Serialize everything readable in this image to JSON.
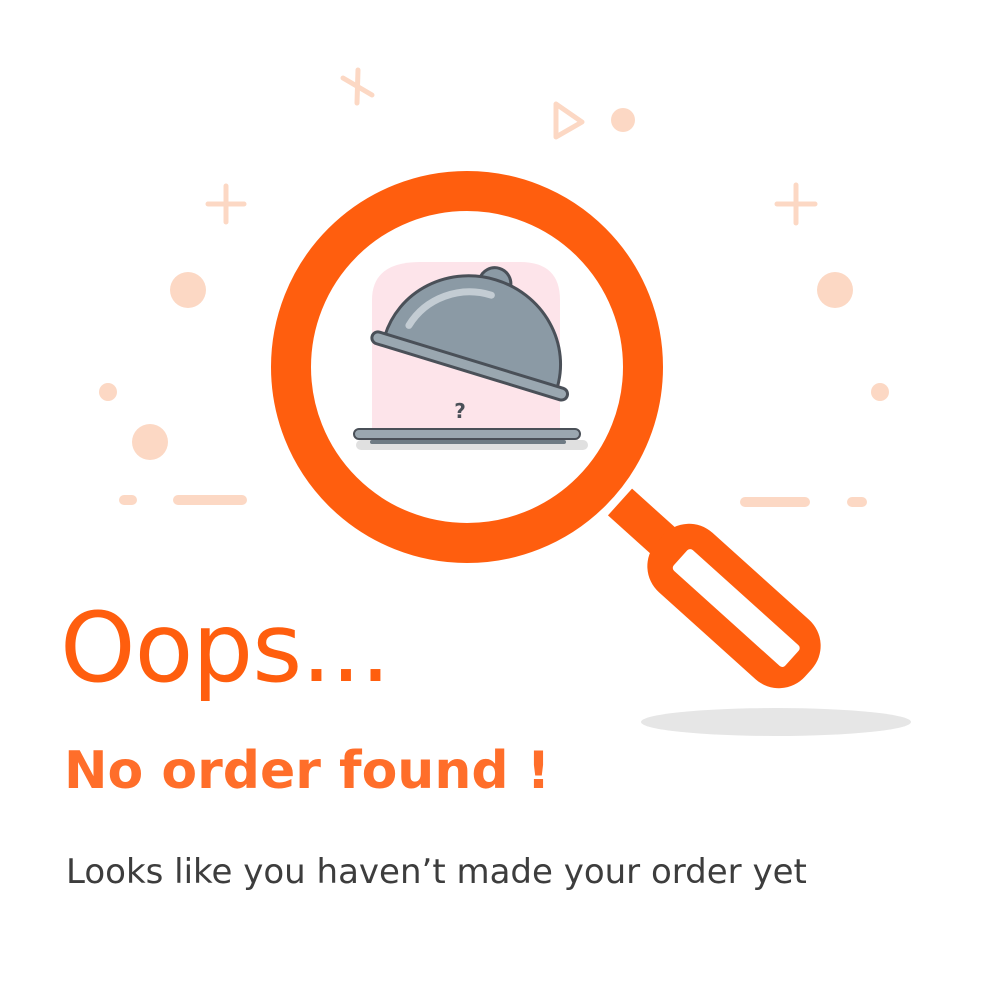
{
  "colors": {
    "accent": "#ff5e0e",
    "accent_light": "#ff6e2a",
    "decor_peach": "#fcd8c4",
    "text_dark": "#3d3d3d",
    "cloche_metal": "#8b9aa5",
    "tray": "#9aa7b0",
    "pink_bg": "#fde4ea",
    "shadow": "#e6e6e6"
  },
  "illustration": {
    "magnifier_icon": "magnifying-glass-icon",
    "cloche_icon": "food-cloche-icon",
    "mark": "?"
  },
  "empty_state": {
    "headline": "Oops...",
    "subheadline": "No order found !",
    "message": "Looks like you haven’t made your order yet"
  }
}
